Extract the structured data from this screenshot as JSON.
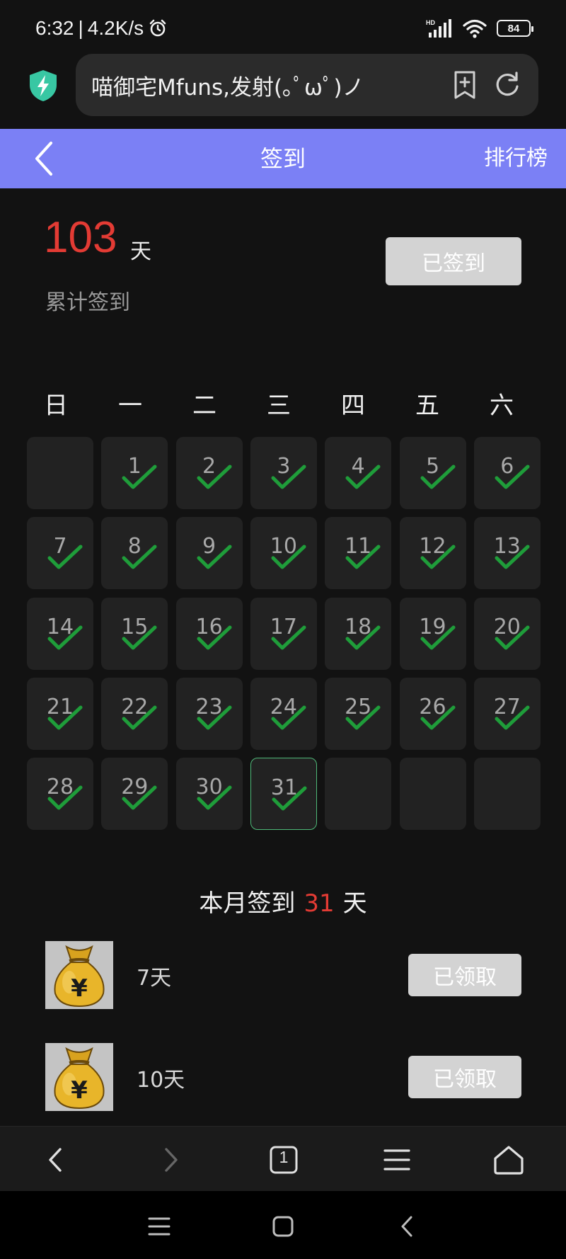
{
  "status_bar": {
    "time": "6:32",
    "net_speed": "4.2K/s",
    "battery": "84",
    "network_badge": "HD",
    "icons": [
      "alarm-icon",
      "signal-icon",
      "wifi-icon",
      "battery-icon"
    ]
  },
  "browser": {
    "url_text": "喵御宅Mfuns,发射(｡ﾟωﾟ)ノ",
    "icons": [
      "shield-icon",
      "add-bookmark-icon",
      "refresh-icon"
    ]
  },
  "header": {
    "title": "签到",
    "rank_link": "排行榜",
    "accent_color": "#7b80f5"
  },
  "summary": {
    "total_days": "103",
    "unit": "天",
    "label": "累计签到",
    "signed_button": "已签到"
  },
  "calendar": {
    "weekdays": [
      "日",
      "一",
      "二",
      "三",
      "四",
      "五",
      "六"
    ],
    "days": [
      "1",
      "2",
      "3",
      "4",
      "5",
      "6",
      "7",
      "8",
      "9",
      "10",
      "11",
      "12",
      "13",
      "14",
      "15",
      "16",
      "17",
      "18",
      "19",
      "20",
      "21",
      "22",
      "23",
      "24",
      "25",
      "26",
      "27",
      "28",
      "29",
      "30",
      "31"
    ],
    "first_weekday_index": 1,
    "signed_days": 31,
    "today": "31",
    "check_color": "#1f9d3a"
  },
  "month_summary": {
    "prefix": "本月签到",
    "count": "31",
    "suffix": "天"
  },
  "rewards": [
    {
      "label": "7天",
      "button": "已领取",
      "icon": "money-bag-icon"
    },
    {
      "label": "10天",
      "button": "已领取",
      "icon": "money-bag-icon"
    }
  ],
  "bottom_nav": {
    "tab_count": "1",
    "icons": [
      "back-icon",
      "forward-icon",
      "tabs-icon",
      "menu-icon",
      "home-icon"
    ]
  },
  "system_nav": {
    "icons": [
      "recent-apps-icon",
      "home-square-icon",
      "system-back-icon"
    ]
  }
}
